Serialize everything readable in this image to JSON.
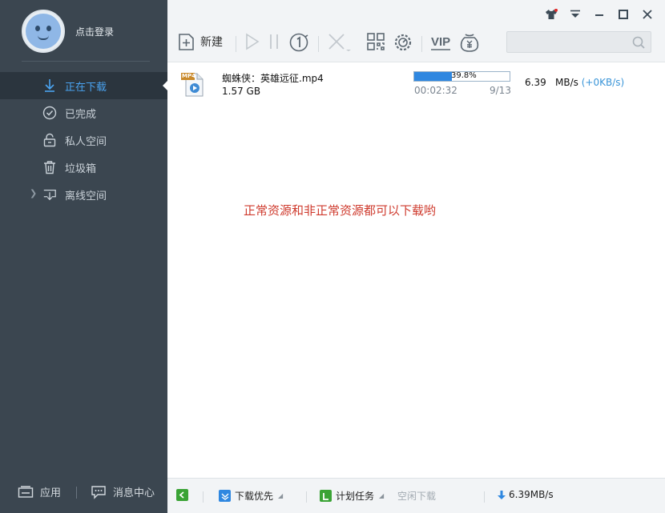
{
  "sidebar": {
    "login_text": "点击登录",
    "nav": [
      {
        "label": "正在下载",
        "icon": "download-arrow-icon",
        "active": true
      },
      {
        "label": "已完成",
        "icon": "check-circle-icon",
        "active": false
      },
      {
        "label": "私人空间",
        "icon": "lock-icon",
        "active": false
      },
      {
        "label": "垃圾箱",
        "icon": "trash-icon",
        "active": false
      },
      {
        "label": "离线空间",
        "icon": "cloud-download-icon",
        "active": false
      }
    ],
    "bottom": {
      "apps_label": "应用",
      "messages_label": "消息中心"
    }
  },
  "toolbar": {
    "new_label": "新建",
    "search": {
      "placeholder": "",
      "value": ""
    }
  },
  "download": {
    "name": "蜘蛛侠：英雄远征.mp4",
    "size": "1.57 GB",
    "file_badge": "MP4",
    "progress_text": "39.8%",
    "progress": 0.398,
    "elapsed": "00:02:32",
    "pieces": "9/13",
    "speed": "6.39",
    "speed_unit": "MB/s",
    "boost": "(+0KB/s)"
  },
  "notice": "正常资源和非正常资源都可以下载哟",
  "statusbar": {
    "priority_label": "下载优先",
    "schedule_label": "计划任务",
    "idle_label": "空闲下载",
    "total_speed": "6.39MB/s"
  },
  "colors": {
    "sidebar_bg": "#3b4650",
    "accent": "#4aa3f0",
    "progress": "#2f87e0",
    "notice": "#cf3b2e",
    "status_green": "#3aa335"
  }
}
